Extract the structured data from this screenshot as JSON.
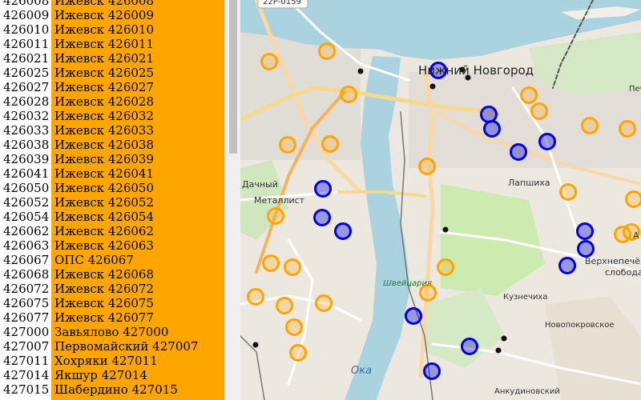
{
  "list": {
    "rows": [
      {
        "code": "426008",
        "name": "Ижевск 426008"
      },
      {
        "code": "426009",
        "name": "Ижевск 426009"
      },
      {
        "code": "426010",
        "name": "Ижевск 426010"
      },
      {
        "code": "426011",
        "name": "Ижевск 426011"
      },
      {
        "code": "426021",
        "name": "Ижевск 426021"
      },
      {
        "code": "426025",
        "name": "Ижевск 426025"
      },
      {
        "code": "426027",
        "name": "Ижевск 426027"
      },
      {
        "code": "426028",
        "name": "Ижевск 426028"
      },
      {
        "code": "426032",
        "name": "Ижевск 426032"
      },
      {
        "code": "426033",
        "name": "Ижевск 426033"
      },
      {
        "code": "426038",
        "name": "Ижевск 426038"
      },
      {
        "code": "426039",
        "name": "Ижевск 426039"
      },
      {
        "code": "426041",
        "name": "Ижевск 426041"
      },
      {
        "code": "426050",
        "name": "Ижевск 426050"
      },
      {
        "code": "426052",
        "name": "Ижевск 426052"
      },
      {
        "code": "426054",
        "name": "Ижевск 426054"
      },
      {
        "code": "426062",
        "name": "Ижевск 426062"
      },
      {
        "code": "426063",
        "name": "Ижевск 426063"
      },
      {
        "code": "426067",
        "name": "ОПС 426067"
      },
      {
        "code": "426068",
        "name": "Ижевск 426068"
      },
      {
        "code": "426072",
        "name": "Ижевск 426072"
      },
      {
        "code": "426075",
        "name": "Ижевск 426075"
      },
      {
        "code": "426077",
        "name": "Ижевск 426077"
      },
      {
        "code": "427000",
        "name": "Завьялово 427000"
      },
      {
        "code": "427007",
        "name": "Первомайский 427007"
      },
      {
        "code": "427011",
        "name": "Хохряки 427011"
      },
      {
        "code": "427014",
        "name": "Якшур 427014"
      },
      {
        "code": "427015",
        "name": "Шабердино 427015"
      }
    ]
  },
  "map": {
    "labels": {
      "road_shield": "22Р-0159",
      "city": "Нижний Новгород",
      "pech": "Печ",
      "dachny": "Дачный",
      "metallist": "Металлист",
      "lapshikha": "Лапшиха",
      "shveitsariya": "Швейцария",
      "verkhnepech": "Верхнепечёр",
      "sloboda": "слобода",
      "kuznechikha": "Кузнечиха",
      "novopokrovskoe": "Новопокровское",
      "oka": "Ока",
      "ankudinovsky": "Анкудиновский",
      "a_suffix": "А"
    },
    "colors": {
      "orange_marker": "#ffa500",
      "blue_marker": "#0000dd",
      "water": "#aad3df",
      "park": "#cdebb0",
      "land": "#ece8e0"
    }
  }
}
